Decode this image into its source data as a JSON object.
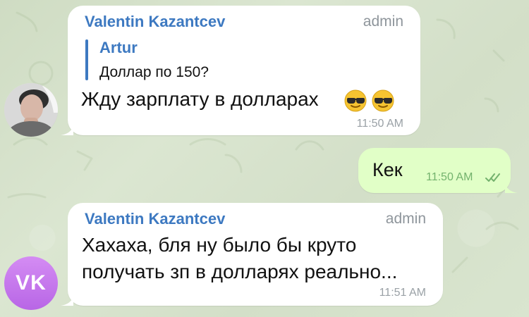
{
  "messages": [
    {
      "sender": "Valentin Kazantcev",
      "role": "admin",
      "reply": {
        "author": "Artur",
        "text": "Доллар по 150?"
      },
      "text": "Жду зарплату в долларах",
      "emoji": [
        "cool-face",
        "cool-face"
      ],
      "time": "11:50 AM"
    },
    {
      "text": "Кек",
      "time": "11:50 AM",
      "read": true
    },
    {
      "sender": "Valentin Kazantcev",
      "role": "admin",
      "text_line1": "Хахаха, бля ну было бы круто",
      "text_line2": "получать зп в долларях реально...",
      "time": "11:51 AM"
    }
  ],
  "avatars": {
    "second": "VK"
  },
  "colors": {
    "accent": "#3d79c1",
    "outgoing": "#e1ffc7",
    "incoming": "#ffffff",
    "initials_avatar": "#c575ec"
  }
}
